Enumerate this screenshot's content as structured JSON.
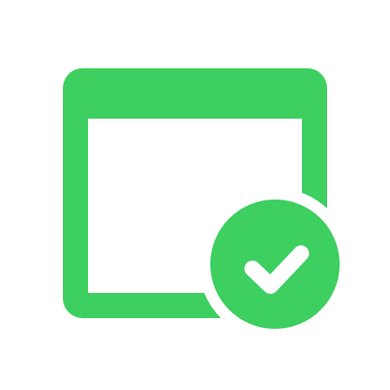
{
  "icon": {
    "window_icon": "browser-window-icon",
    "badge_icon": "check-circle-icon",
    "check_icon": "checkmark-icon"
  },
  "colors": {
    "background": "#ffffff",
    "accent": "#3dcf5f",
    "check": "#ffffff"
  }
}
